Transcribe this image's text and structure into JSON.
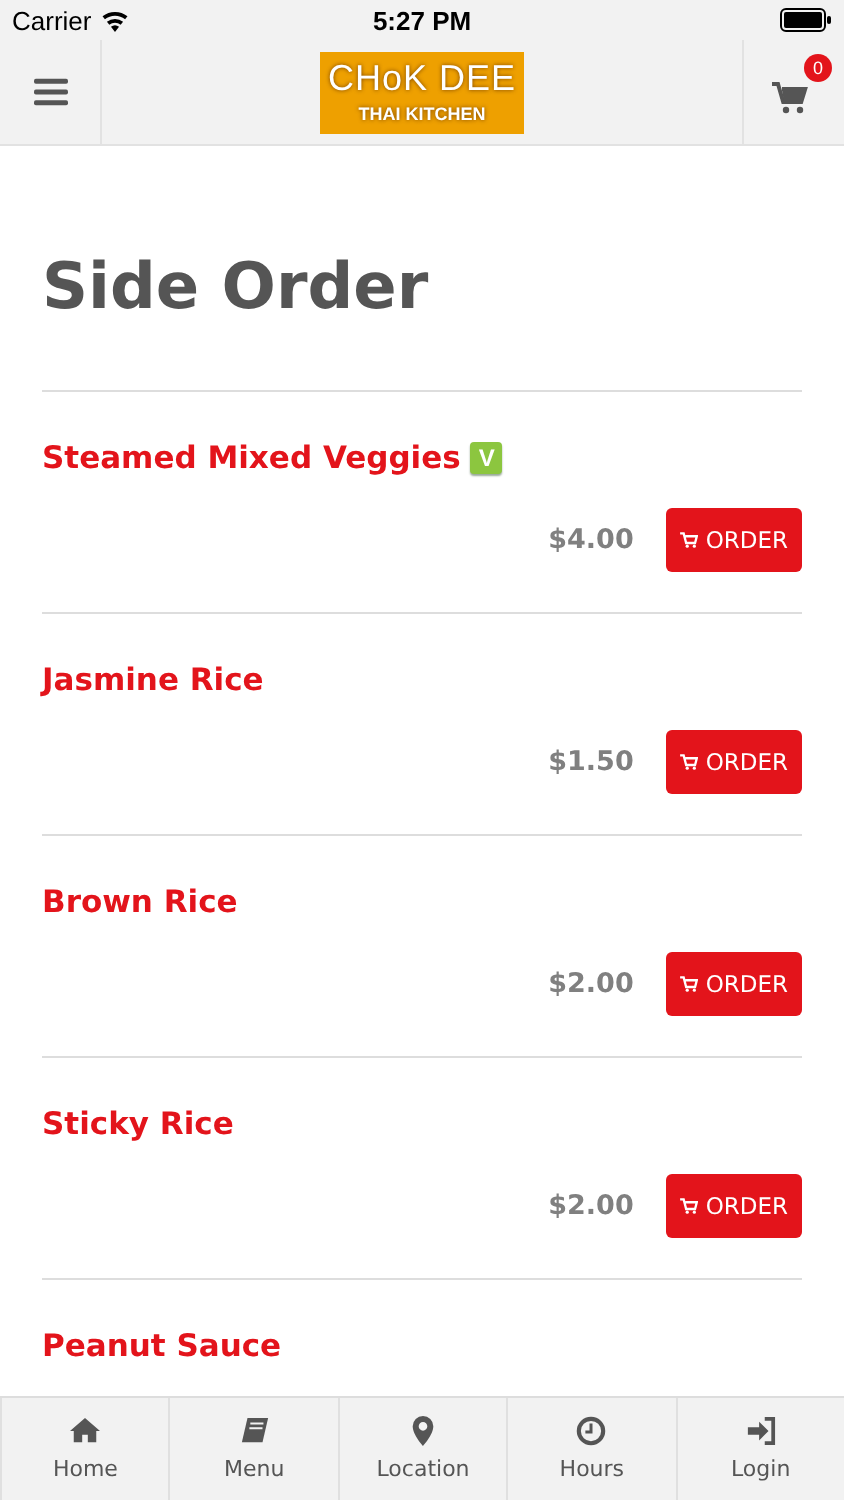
{
  "status_bar": {
    "carrier": "Carrier",
    "time": "5:27 PM"
  },
  "header": {
    "logo": {
      "name": "CHoK DEE",
      "subtitle": "THAI KITCHEN"
    },
    "cart_count": "0"
  },
  "page_title": "Side Order",
  "items": [
    {
      "name": "Steamed Mixed Veggies",
      "badge": "V",
      "price": "$4.00",
      "button": "ORDER"
    },
    {
      "name": "Jasmine Rice",
      "price": "$1.50",
      "button": "ORDER"
    },
    {
      "name": "Brown Rice",
      "price": "$2.00",
      "button": "ORDER"
    },
    {
      "name": "Sticky Rice",
      "price": "$2.00",
      "button": "ORDER"
    },
    {
      "name": "Peanut Sauce"
    }
  ],
  "tab_bar": [
    {
      "kind": "home",
      "label": "Home"
    },
    {
      "kind": "menu",
      "label": "Menu"
    },
    {
      "kind": "location",
      "label": "Location"
    },
    {
      "kind": "hours",
      "label": "Hours"
    },
    {
      "kind": "login",
      "label": "Login"
    }
  ]
}
